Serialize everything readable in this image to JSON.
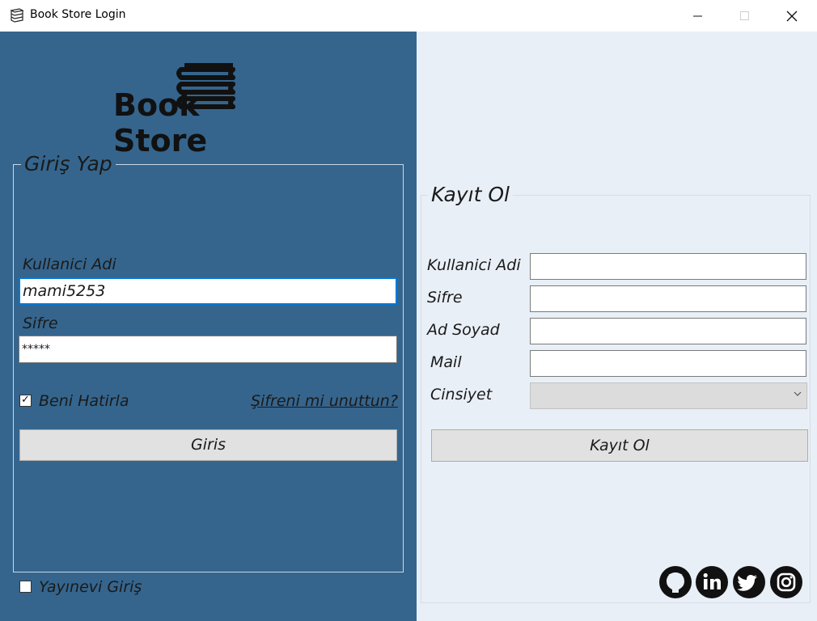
{
  "window": {
    "title": "Book Store Login"
  },
  "logo": {
    "text": "Book Store",
    "icon": "books-icon"
  },
  "login": {
    "legend": "Giriş Yap",
    "username_label": "Kullanici Adi",
    "username_value": "mami5253",
    "password_label": "Sifre",
    "password_value": "*****",
    "remember_label": "Beni Hatirla",
    "remember_checked": true,
    "forgot_link": "Şifreni mi unuttun?",
    "login_button": "Giris",
    "publisher_label": "Yayınevi Giriş",
    "publisher_checked": false
  },
  "register": {
    "legend": "Kayıt Ol",
    "username_label": "Kullanici Adi",
    "password_label": "Sifre",
    "fullname_label": "Ad Soyad",
    "mail_label": "Mail",
    "gender_label": "Cinsiyet",
    "button": "Kayıt Ol"
  },
  "social_icons": [
    "github-icon",
    "linkedin-icon",
    "twitter-icon",
    "instagram-icon"
  ],
  "colors": {
    "left_panel": "#35658d",
    "right_panel": "#e9eff7",
    "focus": "#0078d7"
  }
}
